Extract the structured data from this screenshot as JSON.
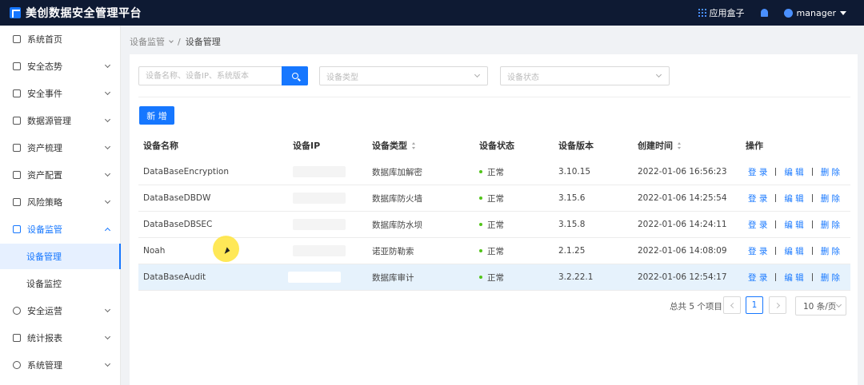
{
  "app": {
    "title": "美创数据安全管理平台"
  },
  "topbar": {
    "apps_label": "应用盒子",
    "user_name": "manager"
  },
  "sidebar": {
    "items": [
      {
        "label": "系统首页",
        "icon": "home-icon"
      },
      {
        "label": "安全态势",
        "icon": "chart-icon"
      },
      {
        "label": "安全事件",
        "icon": "alarm-icon"
      },
      {
        "label": "数据源管理",
        "icon": "database-icon"
      },
      {
        "label": "资产梳理",
        "icon": "asset-sort-icon"
      },
      {
        "label": "资产配置",
        "icon": "asset-config-icon"
      },
      {
        "label": "风险策略",
        "icon": "risk-icon"
      },
      {
        "label": "设备监管",
        "icon": "monitor-icon"
      },
      {
        "label": "安全运营",
        "icon": "shield-icon"
      },
      {
        "label": "统计报表",
        "icon": "report-icon"
      },
      {
        "label": "系统管理",
        "icon": "settings-icon"
      }
    ],
    "sub_items": [
      {
        "label": "设备管理"
      },
      {
        "label": "设备监控"
      }
    ]
  },
  "breadcrumb": {
    "parent": "设备监管",
    "current": "设备管理"
  },
  "filters": {
    "search_placeholder": "设备名称、设备IP、系统版本",
    "type_placeholder": "设备类型",
    "status_placeholder": "设备状态"
  },
  "toolbar": {
    "add_label": "新 增"
  },
  "table": {
    "columns": [
      "设备名称",
      "设备IP",
      "设备类型",
      "设备状态",
      "设备版本",
      "创建时间",
      "操作"
    ],
    "rows": [
      {
        "name": "DataBaseEncryption",
        "type": "数据库加解密",
        "status": "正常",
        "version": "3.10.15",
        "created": "2022-01-06 16:56:23"
      },
      {
        "name": "DataBaseDBDW",
        "type": "数据库防火墙",
        "status": "正常",
        "version": "3.15.6",
        "created": "2022-01-06 14:25:54"
      },
      {
        "name": "DataBaseDBSEC",
        "type": "数据库防水坝",
        "status": "正常",
        "version": "3.15.8",
        "created": "2022-01-06 14:24:11"
      },
      {
        "name": "Noah",
        "type": "诺亚防勒索",
        "status": "正常",
        "version": "2.1.25",
        "created": "2022-01-06 14:08:09"
      },
      {
        "name": "DataBaseAudit",
        "type": "数据库审计",
        "status": "正常",
        "version": "3.2.22.1",
        "created": "2022-01-06 12:54:17"
      }
    ],
    "actions": {
      "login": "登 录",
      "edit": "编 辑",
      "delete": "删 除"
    }
  },
  "pagination": {
    "total_text": "总共 5 个项目",
    "current_page": "1",
    "page_size": "10 条/页"
  },
  "colors": {
    "primary": "#1677ff",
    "topbar": "#0e1a33",
    "success": "#52c41a"
  }
}
